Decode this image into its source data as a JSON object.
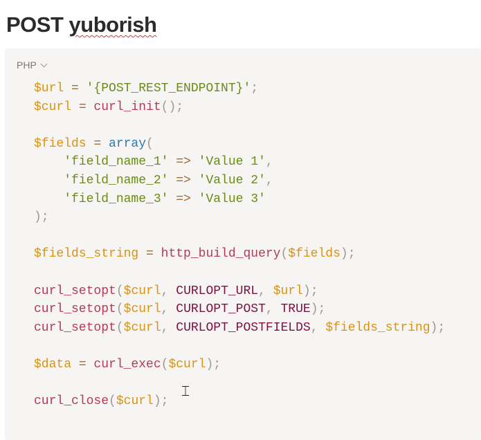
{
  "page": {
    "title_word1": "POST",
    "title_word2": "yuborish"
  },
  "code_block": {
    "language": "PHP",
    "lines": [
      [
        [
          "$url",
          "v"
        ],
        [
          " = ",
          "o"
        ],
        [
          "'{POST_REST_ENDPOINT}'",
          "s"
        ],
        [
          ";",
          "p"
        ]
      ],
      [
        [
          "$curl",
          "v"
        ],
        [
          " = ",
          "o"
        ],
        [
          "curl_init",
          "f"
        ],
        [
          "();",
          "p"
        ]
      ],
      [],
      [
        [
          "$fields",
          "v"
        ],
        [
          " = ",
          "o"
        ],
        [
          "array",
          "b"
        ],
        [
          "(",
          "p"
        ]
      ],
      [
        [
          "    'field_name_1'",
          "s"
        ],
        [
          " => ",
          "o"
        ],
        [
          "'Value 1'",
          "s"
        ],
        [
          ",",
          "p"
        ]
      ],
      [
        [
          "    'field_name_2'",
          "s"
        ],
        [
          " => ",
          "o"
        ],
        [
          "'Value 2'",
          "s"
        ],
        [
          ",",
          "p"
        ]
      ],
      [
        [
          "    'field_name_3'",
          "s"
        ],
        [
          " => ",
          "o"
        ],
        [
          "'Value 3'",
          "s"
        ]
      ],
      [
        [
          ");",
          "p"
        ]
      ],
      [],
      [
        [
          "$fields_string",
          "v"
        ],
        [
          " = ",
          "o"
        ],
        [
          "http_build_query",
          "f"
        ],
        [
          "(",
          "p"
        ],
        [
          "$fields",
          "v"
        ],
        [
          ");",
          "p"
        ]
      ],
      [],
      [
        [
          "curl_setopt",
          "f"
        ],
        [
          "(",
          "p"
        ],
        [
          "$curl",
          "v"
        ],
        [
          ", ",
          "p"
        ],
        [
          "CURLOPT_URL",
          "k"
        ],
        [
          ", ",
          "p"
        ],
        [
          "$url",
          "v"
        ],
        [
          ");",
          "p"
        ]
      ],
      [
        [
          "curl_setopt",
          "f"
        ],
        [
          "(",
          "p"
        ],
        [
          "$curl",
          "v"
        ],
        [
          ", ",
          "p"
        ],
        [
          "CURLOPT_POST",
          "k"
        ],
        [
          ", ",
          "p"
        ],
        [
          "TRUE",
          "k"
        ],
        [
          ");",
          "p"
        ]
      ],
      [
        [
          "curl_setopt",
          "f"
        ],
        [
          "(",
          "p"
        ],
        [
          "$curl",
          "v"
        ],
        [
          ", ",
          "p"
        ],
        [
          "CURLOPT_POSTFIELDS",
          "k"
        ],
        [
          ", ",
          "p"
        ],
        [
          "$fields_string",
          "v"
        ],
        [
          ");",
          "p"
        ]
      ],
      [],
      [
        [
          "$data",
          "v"
        ],
        [
          " = ",
          "o"
        ],
        [
          "curl_exec",
          "f"
        ],
        [
          "(",
          "p"
        ],
        [
          "$curl",
          "v"
        ],
        [
          ");",
          "p"
        ]
      ],
      [],
      [
        [
          "curl_close",
          "f"
        ],
        [
          "(",
          "p"
        ],
        [
          "$curl",
          "v"
        ],
        [
          ");",
          "p"
        ]
      ]
    ]
  },
  "colors": {
    "variable": "#d9930f",
    "function": "#b53a55",
    "constant": "#7a1140",
    "string": "#6a8b1a",
    "keyword": "#2a7ab0"
  }
}
